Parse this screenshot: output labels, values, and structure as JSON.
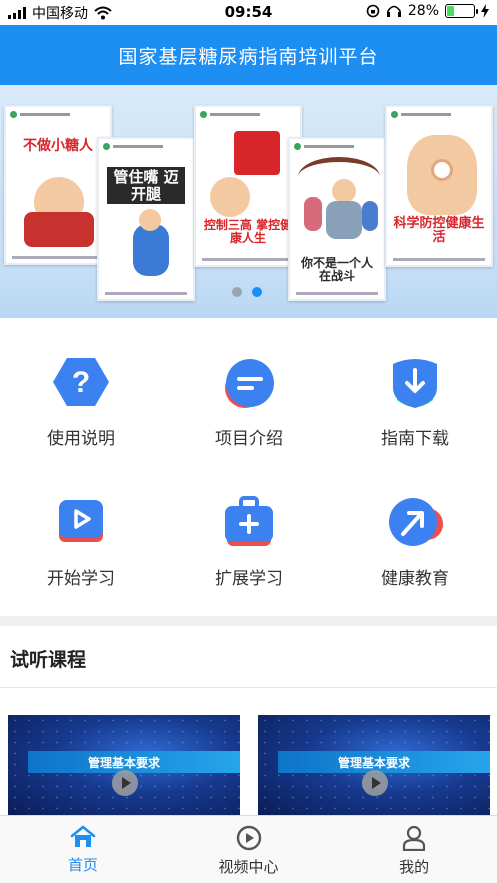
{
  "status_bar": {
    "carrier": "中国移动",
    "time": "09:54",
    "battery": "28%",
    "battery_level": 0.28
  },
  "header": {
    "title": "国家基层糖尿病指南培训平台"
  },
  "banner": {
    "posters": [
      {
        "title": "不做小糖人",
        "color": "#d8262b"
      },
      {
        "title": "管住嘴 迈开腿",
        "color": "#2a2a2a"
      },
      {
        "title": "控制三高 掌控健康人生",
        "color": "#d8262b"
      },
      {
        "title": "你不是一个人在战斗",
        "color": "#2a2a2a"
      },
      {
        "title": "科学防控健康生活",
        "color": "#d8262b"
      }
    ],
    "active_index": 1,
    "dot_count": 2
  },
  "menu": [
    {
      "label": "使用说明",
      "icon": "question-icon"
    },
    {
      "label": "项目介绍",
      "icon": "list-icon"
    },
    {
      "label": "指南下载",
      "icon": "download-icon"
    },
    {
      "label": "开始学习",
      "icon": "play-video-icon"
    },
    {
      "label": "扩展学习",
      "icon": "medical-kit-icon"
    },
    {
      "label": "健康教育",
      "icon": "arrow-up-right-icon"
    }
  ],
  "trial": {
    "title": "试听课程",
    "courses": [
      {
        "title": "管理基本要求"
      },
      {
        "title": "管理基本要求"
      }
    ]
  },
  "tabbar": {
    "tabs": [
      {
        "label": "首页",
        "icon": "home-icon",
        "active": true
      },
      {
        "label": "视频中心",
        "icon": "play-circle-icon",
        "active": false
      },
      {
        "label": "我的",
        "icon": "user-icon",
        "active": false
      }
    ]
  },
  "colors": {
    "brand": "#1e8ff2",
    "accent_red": "#ef4d4d",
    "accent_green": "#2bd67b"
  }
}
